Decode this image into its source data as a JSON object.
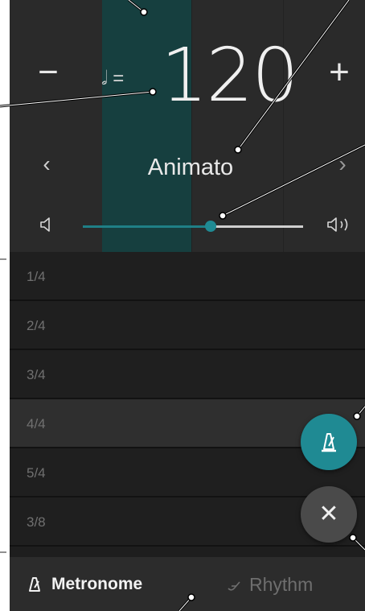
{
  "tempo": {
    "minus_label": "−",
    "plus_label": "+",
    "note_equals": "𝅗𝅥 =",
    "bpm": "120",
    "name": "Animato",
    "prev_label": "‹",
    "next_label": "›"
  },
  "volume": {
    "level": 0.58,
    "low_icon": "speaker-low-icon",
    "high_icon": "speaker-high-icon"
  },
  "time_signatures": {
    "items": [
      "1/4",
      "2/4",
      "3/4",
      "4/4",
      "5/4",
      "3/8"
    ],
    "selected": "4/4"
  },
  "fabs": {
    "metronome_icon": "metronome-icon",
    "close_label": "✕"
  },
  "tabs": {
    "metronome": "Metronome",
    "rhythm": "Rhythm"
  },
  "colors": {
    "accent": "#1f8a93",
    "highlight": "#163f3f",
    "background": "#1e1e1e"
  }
}
